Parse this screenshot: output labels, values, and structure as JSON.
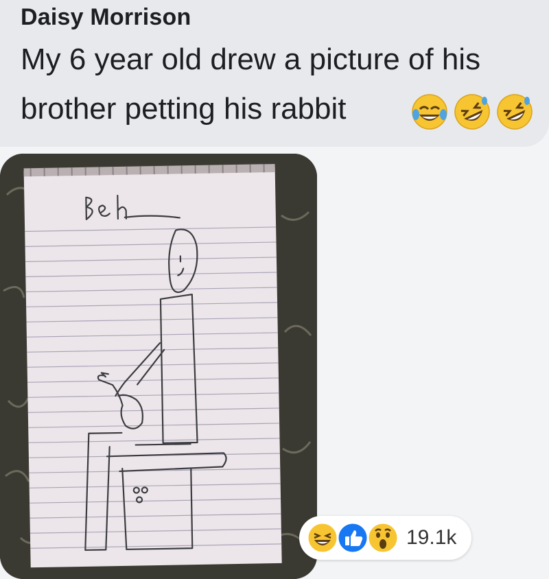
{
  "post": {
    "author": "Daisy Morrison",
    "message_line1": "My 6 year old drew a picture of his",
    "message_line2": "brother petting his rabbit",
    "emojis": [
      "face-with-tears-of-joy-icon",
      "rolling-on-floor-laughing-icon",
      "rolling-on-floor-laughing-icon"
    ]
  },
  "drawing": {
    "handwritten_name": "Ben"
  },
  "reactions": {
    "icons": [
      "laugh-reaction-icon",
      "like-reaction-icon",
      "wow-reaction-icon"
    ],
    "count": "19.1k"
  },
  "colors": {
    "bubble": "#e8e9ec",
    "page_bg": "#f3f4f6",
    "like_blue": "#1877f2",
    "emoji_yellow": "#f7c531"
  }
}
